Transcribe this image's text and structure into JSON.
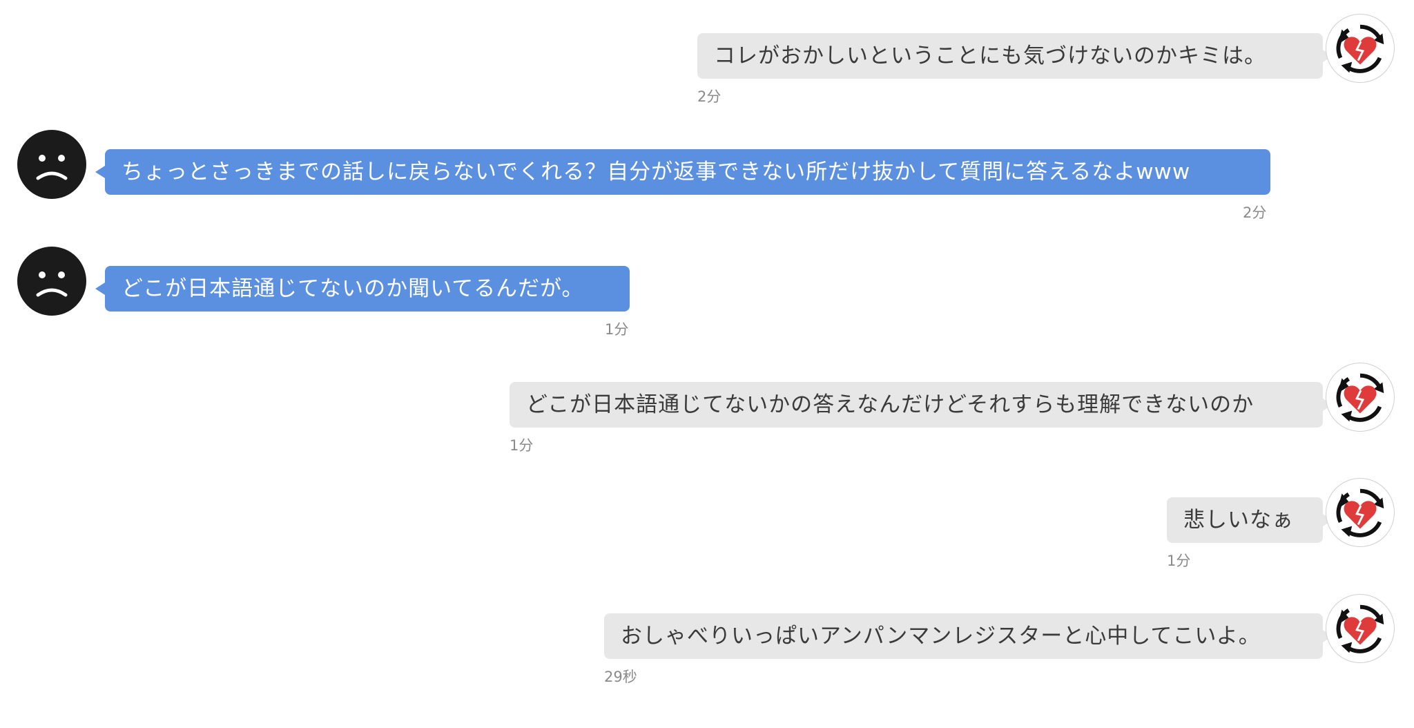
{
  "messages": [
    {
      "side": "outgoing",
      "text": "コレがおかしいということにも気づけないのかキミは。",
      "time": "2分",
      "avatar": "broken-heart-cycle-icon"
    },
    {
      "side": "incoming",
      "text": "ちょっとさっきまでの話しに戻らないでくれる？自分が返事できない所だけ抜かして質問に答えるなよwww",
      "time": "2分",
      "avatar": "sad-face-icon"
    },
    {
      "side": "incoming",
      "text": "どこが日本語通じてないのか聞いてるんだが。",
      "time": "1分",
      "avatar": "sad-face-icon"
    },
    {
      "side": "outgoing",
      "text": "どこが日本語通じてないかの答えなんだけどそれすらも理解できないのか",
      "time": "1分",
      "avatar": "broken-heart-cycle-icon"
    },
    {
      "side": "outgoing",
      "text": "悲しいなぁ",
      "time": "1分",
      "avatar": "broken-heart-cycle-icon"
    },
    {
      "side": "outgoing",
      "text": "おしゃべりいっぱいアンパンマンレジスターと心中してこいよ。",
      "time": "29秒",
      "avatar": "broken-heart-cycle-icon"
    }
  ],
  "colors": {
    "incoming_bubble": "#5b8fe0",
    "outgoing_bubble": "#e7e7e7",
    "timestamp": "#8a8a8a"
  }
}
